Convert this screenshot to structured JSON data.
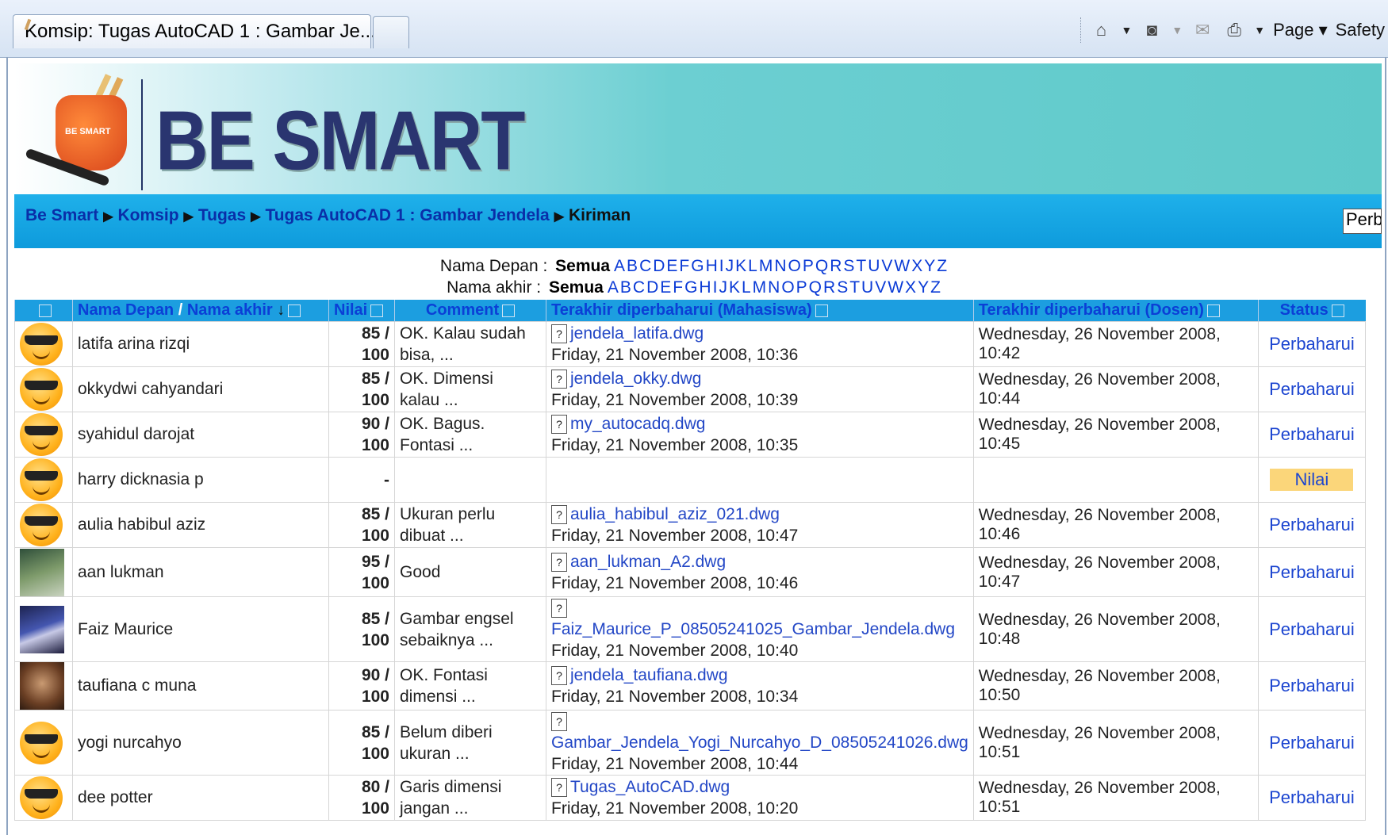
{
  "browser": {
    "tab_title": "Komsip: Tugas AutoCAD 1 : Gambar Je...",
    "page_label": "Page",
    "safety_label": "Safety"
  },
  "site": {
    "logo_text": "BE SMART",
    "mug_text": "BE SMART",
    "breadcrumbs": [
      "Be Smart",
      "Komsip",
      "Tugas",
      "Tugas AutoCAD 1 : Gambar Jendela"
    ],
    "current": "Kiriman",
    "nav_button": "Perbaharui"
  },
  "filters": {
    "first_label": "Nama Depan :",
    "last_label": "Nama akhir :",
    "all": "Semua",
    "letters": [
      "A",
      "B",
      "C",
      "D",
      "E",
      "F",
      "G",
      "H",
      "I",
      "J",
      "K",
      "L",
      "M",
      "N",
      "O",
      "P",
      "Q",
      "R",
      "S",
      "T",
      "U",
      "V",
      "W",
      "X",
      "Y",
      "Z"
    ]
  },
  "table": {
    "headers": {
      "first_name": "Nama Depan",
      "slash": "/",
      "last_name": "Nama akhir",
      "sort_icon": "↓",
      "grade": "Nilai",
      "comment": "Comment",
      "student_updated": "Terakhir diperbaharui (Mahasiswa)",
      "teacher_updated": "Terakhir diperbaharui (Dosen)",
      "status": "Status"
    },
    "rows": [
      {
        "avatar": "smiley",
        "name": "latifa arina rizqi",
        "grade": "85 /",
        "max": "100",
        "comment1": "OK. Kalau sudah",
        "comment2": "bisa, ...",
        "file": "jendela_latifa.dwg",
        "sdate": "Friday, 21 November 2008, 10:36",
        "tdate": "Wednesday, 26 November 2008, 10:42",
        "status": "Perbaharui"
      },
      {
        "avatar": "smiley",
        "name": "okkydwi cahyandari",
        "grade": "85 /",
        "max": "100",
        "comment1": "OK. Dimensi",
        "comment2": "kalau ...",
        "file": "jendela_okky.dwg",
        "sdate": "Friday, 21 November 2008, 10:39",
        "tdate": "Wednesday, 26 November 2008, 10:44",
        "status": "Perbaharui"
      },
      {
        "avatar": "smiley",
        "name": "syahidul darojat",
        "grade": "90 /",
        "max": "100",
        "comment1": "OK. Bagus.",
        "comment2": "Fontasi ...",
        "file": "my_autocadq.dwg",
        "sdate": "Friday, 21 November 2008, 10:35",
        "tdate": "Wednesday, 26 November 2008, 10:45",
        "status": "Perbaharui"
      },
      {
        "avatar": "smiley",
        "name": "harry dicknasia p",
        "grade": "-",
        "max": "",
        "comment1": "",
        "comment2": "",
        "file": "",
        "sdate": "",
        "tdate": "",
        "status": "Nilai"
      },
      {
        "avatar": "smiley",
        "name": "aulia habibul aziz",
        "grade": "85 /",
        "max": "100",
        "comment1": "Ukuran perlu",
        "comment2": "dibuat ...",
        "file": "aulia_habibul_aziz_021.dwg",
        "sdate": "Friday, 21 November 2008, 10:47",
        "tdate": "Wednesday, 26 November 2008, 10:46",
        "status": "Perbaharui"
      },
      {
        "avatar": "photo1",
        "name": "aan lukman",
        "grade": "95 /",
        "max": "100",
        "comment1": "Good",
        "comment2": "",
        "file": "aan_lukman_A2.dwg",
        "sdate": "Friday, 21 November 2008, 10:46",
        "tdate": "Wednesday, 26 November 2008, 10:47",
        "status": "Perbaharui"
      },
      {
        "avatar": "photo2",
        "name": "Faiz Maurice",
        "grade": "85 /",
        "max": "100",
        "comment1": "Gambar engsel",
        "comment2": "sebaiknya ...",
        "file": "Faiz_Maurice_P_08505241025_Gambar_Jendela.dwg",
        "sdate": "Friday, 21 November 2008, 10:40",
        "tdate": "Wednesday, 26 November 2008, 10:48",
        "status": "Perbaharui"
      },
      {
        "avatar": "photo3",
        "name": "taufiana c muna",
        "grade": "90 /",
        "max": "100",
        "comment1": "OK. Fontasi",
        "comment2": "dimensi ...",
        "file": "jendela_taufiana.dwg",
        "sdate": "Friday, 21 November 2008, 10:34",
        "tdate": "Wednesday, 26 November 2008, 10:50",
        "status": "Perbaharui"
      },
      {
        "avatar": "smiley",
        "name": "yogi nurcahyo",
        "grade": "85 /",
        "max": "100",
        "comment1": "Belum diberi",
        "comment2": "ukuran ...",
        "file": "Gambar_Jendela_Yogi_Nurcahyo_D_08505241026.dwg",
        "sdate": "Friday, 21 November 2008, 10:44",
        "tdate": "Wednesday, 26 November 2008, 10:51",
        "status": "Perbaharui"
      },
      {
        "avatar": "smiley",
        "name": "dee potter",
        "grade": "80 /",
        "max": "100",
        "comment1": "Garis dimensi",
        "comment2": "jangan ...",
        "file": "Tugas_AutoCAD.dwg",
        "sdate": "Friday, 21 November 2008, 10:20",
        "tdate": "Wednesday, 26 November 2008, 10:51",
        "status": "Perbaharui"
      }
    ]
  }
}
